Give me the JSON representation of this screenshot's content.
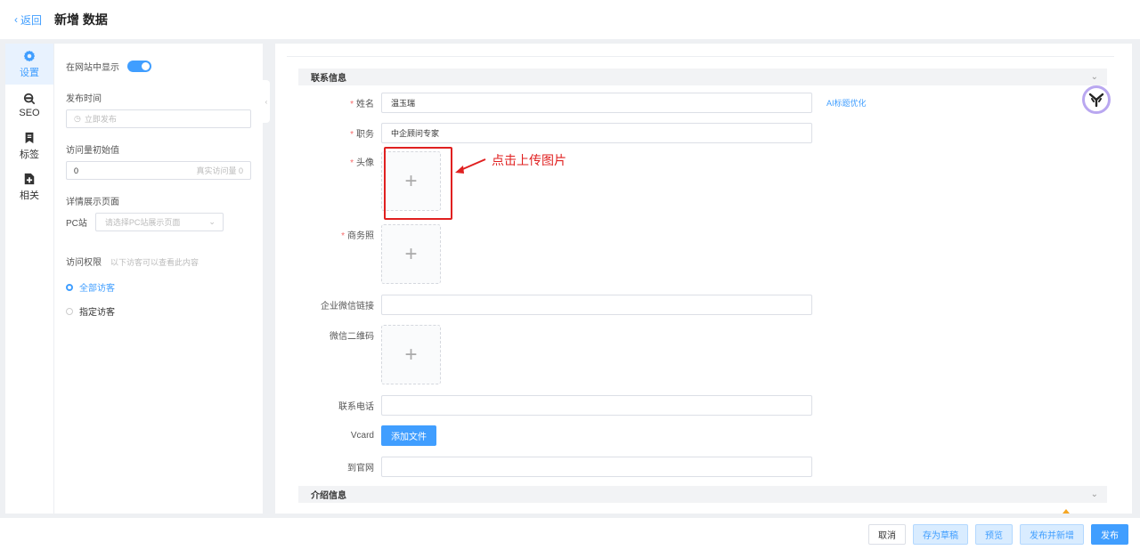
{
  "header": {
    "back_label": "返回",
    "title": "新增 数据"
  },
  "iconbar": {
    "items": [
      {
        "label": "设置",
        "icon": "gear-icon",
        "active": true
      },
      {
        "label": "SEO",
        "icon": "seo-icon",
        "active": false
      },
      {
        "label": "标签",
        "icon": "bookmark-icon",
        "active": false
      },
      {
        "label": "相关",
        "icon": "file-add-icon",
        "active": false
      }
    ]
  },
  "settings": {
    "show_on_site_label": "在网站中显示",
    "show_on_site": true,
    "publish_time_label": "发布时间",
    "publish_time_placeholder": "立即发布",
    "views_init_label": "访问量初始值",
    "views_init_value": "0",
    "views_real_label": "真实访问量 0",
    "detail_page_label": "详情展示页面",
    "pc_label": "PC站",
    "pc_placeholder": "请选择PC站展示页面",
    "permission_label": "访问权限",
    "permission_hint": "以下访客可以查看此内容",
    "options": [
      {
        "label": "全部访客",
        "checked": true
      },
      {
        "label": "指定访客",
        "checked": false
      }
    ]
  },
  "contact": {
    "section_title": "联系信息",
    "name_label": "姓名",
    "name_value": "温玉瑞",
    "ai_link": "AI标题优化",
    "position_label": "职务",
    "position_value": "中企顾问专家",
    "avatar_label": "头像",
    "biz_photo_label": "商务照",
    "wecom_label": "企业微信链接",
    "wecom_value": "",
    "wechat_qr_label": "微信二维码",
    "phone_label": "联系电话",
    "phone_value": "",
    "vcard_label": "Vcard",
    "add_file_label": "添加文件",
    "website_label": "到官网",
    "website_value": ""
  },
  "intro": {
    "section_title": "介绍信息"
  },
  "annotation": {
    "text": "点击上传图片",
    "color": "#e02020"
  },
  "footer": {
    "cancel": "取消",
    "save_draft": "存为草稿",
    "preview": "预览",
    "publish_new": "发布并新增",
    "publish": "发布"
  },
  "colors": {
    "accent": "#409eff",
    "required": "#f56c6c",
    "annotation": "#e02020"
  }
}
